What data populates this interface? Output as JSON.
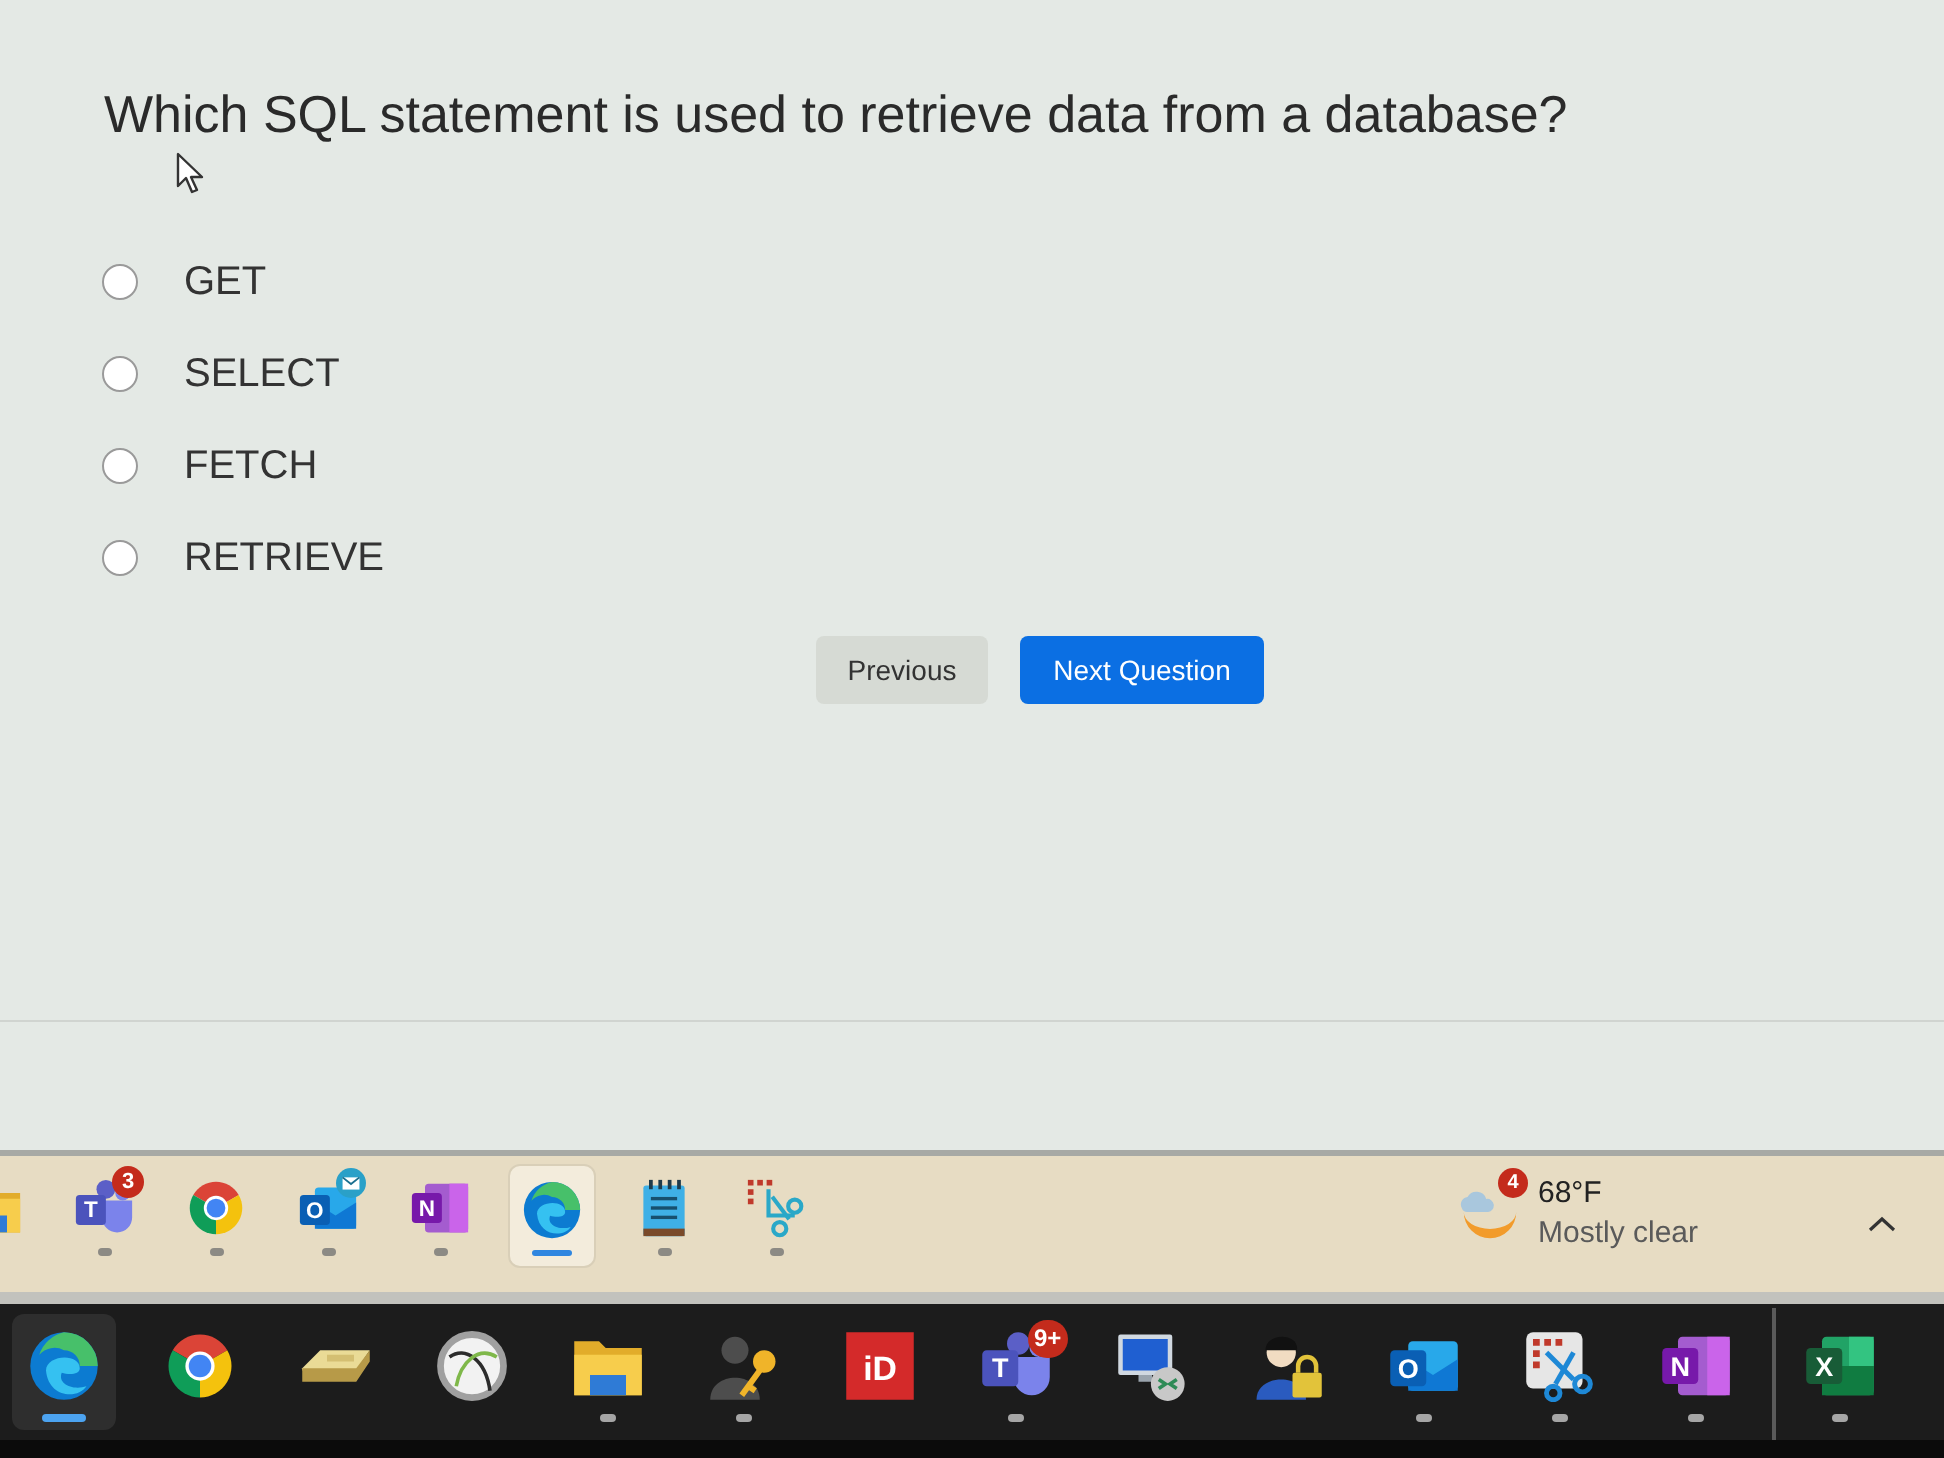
{
  "question": "Which SQL statement is used to retrieve data from a database?",
  "options": [
    {
      "label": "GET",
      "selected": false
    },
    {
      "label": "SELECT",
      "selected": false
    },
    {
      "label": "FETCH",
      "selected": false
    },
    {
      "label": "RETRIEVE",
      "selected": false
    }
  ],
  "buttons": [
    {
      "kind": "back",
      "label": "Previous"
    },
    {
      "kind": "next",
      "label": "Next Question"
    }
  ],
  "taskbar_top": {
    "apps": [
      {
        "kind": "folder",
        "running": false,
        "selected": false
      },
      {
        "kind": "teams",
        "letter": "T",
        "badge": {
          "kind": "count",
          "text": "3"
        },
        "running": true,
        "selected": false
      },
      {
        "kind": "chrome",
        "running": true,
        "selected": false
      },
      {
        "kind": "outlook",
        "letter": "O",
        "badge": {
          "kind": "mail"
        },
        "running": true,
        "selected": false
      },
      {
        "kind": "onenote",
        "letter": "N",
        "running": true,
        "selected": false
      },
      {
        "kind": "edge",
        "running": true,
        "selected": true
      },
      {
        "kind": "notepad",
        "running": true,
        "selected": false
      },
      {
        "kind": "snip",
        "running": true,
        "selected": false
      }
    ],
    "weather": {
      "badge": "4",
      "temperature": "68°F",
      "condition": "Mostly clear"
    }
  },
  "taskbar_bottom": {
    "app_groups": [
      {
        "apps": [
          {
            "kind": "edge",
            "running": true,
            "selected": true
          },
          {
            "kind": "chrome",
            "running": false,
            "selected": false
          },
          {
            "kind": "scanner",
            "running": false,
            "selected": false
          },
          {
            "kind": "globe",
            "running": false,
            "selected": false
          },
          {
            "kind": "folder",
            "running": true,
            "selected": false
          },
          {
            "kind": "personkey",
            "running": true,
            "selected": false
          },
          {
            "kind": "idtile",
            "letter": "iD",
            "running": false,
            "selected": false
          },
          {
            "kind": "teams",
            "letter": "T",
            "badge": {
              "kind": "count",
              "text": "9+"
            },
            "running": true,
            "selected": false
          },
          {
            "kind": "remote",
            "running": false,
            "selected": false
          },
          {
            "kind": "personlock",
            "running": false,
            "selected": false
          },
          {
            "kind": "outlook",
            "letter": "O",
            "running": true,
            "selected": false
          },
          {
            "kind": "snipbox",
            "running": true,
            "selected": false
          },
          {
            "kind": "onenote",
            "letter": "N",
            "running": true,
            "selected": false
          }
        ]
      },
      {
        "apps": [
          {
            "kind": "excel",
            "letter": "X",
            "running": true,
            "selected": false
          }
        ]
      }
    ]
  }
}
